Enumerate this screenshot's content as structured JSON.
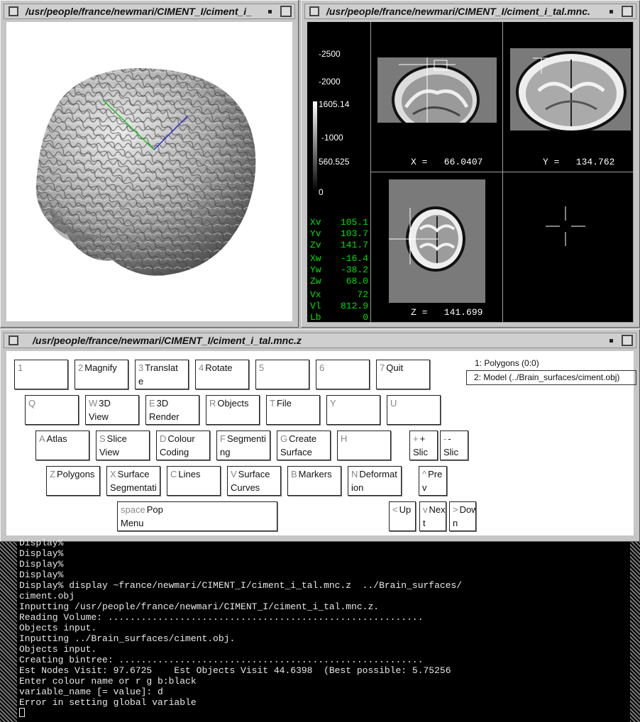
{
  "windows": {
    "brain3d_title": "/usr/people/france/newmari/CIMENT_I/ciment_i_",
    "slices_title": "/usr/people/france/newmari/CIMENT_I/ciment_i_tal.mnc.",
    "menu_title": "/usr/people/france/newmari/CIMENT_I/ciment_i_tal.mnc.z"
  },
  "colorbar": {
    "ticks": [
      "-2500",
      "-2000",
      "1605.14",
      "-1000",
      "560.525",
      "0"
    ]
  },
  "slices": {
    "x_label": "X =   66.0407",
    "y_label": "Y =   134.762",
    "z_label": "Z =   141.699"
  },
  "readout": {
    "rows": [
      {
        "k": "Xv",
        "v": "105.1"
      },
      {
        "k": "Yv",
        "v": "103.7"
      },
      {
        "k": "Zv",
        "v": "141.7"
      },
      {
        "k": "Xw",
        "v": "-16.4"
      },
      {
        "k": "Yw",
        "v": "-38.2"
      },
      {
        "k": "Zw",
        "v": "68.0"
      },
      {
        "k": "Vx",
        "v": "72"
      },
      {
        "k": "Vl",
        "v": "812.9"
      },
      {
        "k": "Lb",
        "v": "0"
      }
    ]
  },
  "objects_list": {
    "item1": "1: Polygons (0:0)",
    "item2": "2: Model (../Brain_surfaces/ciment.obj)"
  },
  "menu_keys": {
    "b1": {
      "k": "1",
      "l1": "",
      "l2": ""
    },
    "b2": {
      "k": "2",
      "l1": "Magnify",
      "l2": ""
    },
    "b3": {
      "k": "3",
      "l1": "Translat",
      "l2": "e"
    },
    "b4": {
      "k": "4",
      "l1": "Rotate",
      "l2": ""
    },
    "b5": {
      "k": "5",
      "l1": "",
      "l2": ""
    },
    "b6": {
      "k": "6",
      "l1": "",
      "l2": ""
    },
    "b7": {
      "k": "7",
      "l1": "Quit",
      "l2": ""
    },
    "bQ": {
      "k": "Q",
      "l1": "",
      "l2": ""
    },
    "bW": {
      "k": "W",
      "l1": "3D",
      "l2": "View"
    },
    "bE": {
      "k": "E",
      "l1": "3D",
      "l2": "Render"
    },
    "bR": {
      "k": "R",
      "l1": "Objects",
      "l2": ""
    },
    "bT": {
      "k": "T",
      "l1": "File",
      "l2": ""
    },
    "bY": {
      "k": "Y",
      "l1": "",
      "l2": ""
    },
    "bU": {
      "k": "U",
      "l1": "",
      "l2": ""
    },
    "bA": {
      "k": "A",
      "l1": "Atlas",
      "l2": ""
    },
    "bS": {
      "k": "S",
      "l1": "Slice",
      "l2": "View"
    },
    "bD": {
      "k": "D",
      "l1": "Colour",
      "l2": "Coding"
    },
    "bF": {
      "k": "F",
      "l1": "Segmenti",
      "l2": "ng"
    },
    "bG": {
      "k": "G",
      "l1": "Create",
      "l2": "Surface"
    },
    "bH": {
      "k": "H",
      "l1": "",
      "l2": ""
    },
    "bPlus": {
      "k": "+",
      "l1": "+",
      "l2": "Slic"
    },
    "bMinus": {
      "k": "-",
      "l1": "-",
      "l2": "Slic"
    },
    "bZ": {
      "k": "Z",
      "l1": "Polygons",
      "l2": ""
    },
    "bX": {
      "k": "X",
      "l1": "Surface",
      "l2": "Segmentati"
    },
    "bC": {
      "k": "C",
      "l1": "Lines",
      "l2": ""
    },
    "bV": {
      "k": "V",
      "l1": "Surface",
      "l2": "Curves"
    },
    "bB": {
      "k": "B",
      "l1": "Markers",
      "l2": ""
    },
    "bN": {
      "k": "N",
      "l1": "Deformat",
      "l2": "ion"
    },
    "bPrev": {
      "k": "^",
      "l1": "Pre",
      "l2": "v"
    },
    "bSpace": {
      "k": "space",
      "l1": "Pop",
      "l2": "Menu"
    },
    "bUp": {
      "k": "<",
      "l1": "Up",
      "l2": ""
    },
    "bNext": {
      "k": "v",
      "l1": "Nex",
      "l2": "t"
    },
    "bDown": {
      "k": ">",
      "l1": "Dow",
      "l2": "n"
    }
  },
  "terminal": {
    "text": "Display%\nDisplay%\nDisplay%\nDisplay%\nDisplay% display ~france/newmari/CIMENT_I/ciment_i_tal.mnc.z  ../Brain_surfaces/\nciment.obj\nInputting /usr/people/france/newmari/CIMENT_I/ciment_i_tal.mnc.z.\nReading Volume: .........................................................\nObjects input.\nInputting ../Brain_surfaces/ciment.obj.\nObjects input.\nCreating bintree: .......................................................\nEst Nodes Visit: 97.6725    Est Objects Visit 44.6398  (Best possible: 5.75256\nEnter colour name or r g b:black\nvariable_name [= value]: d\nError in setting global variable"
  }
}
